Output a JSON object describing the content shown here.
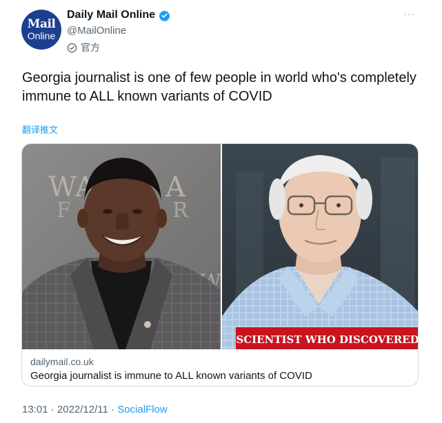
{
  "account": {
    "name": "Daily Mail Online",
    "handle": "@MailOnline",
    "official_label": "官方",
    "avatar_line1": "Mail",
    "avatar_line2": "Online",
    "verified_icon": "verified-badge-icon",
    "brand_color": "#1c3f8f"
  },
  "tweet": {
    "text": "Georgia journalist is one of few people in world who's completely immune to ALL known variants of COVID",
    "translate_label": "翻译推文",
    "more_label": "···"
  },
  "card": {
    "image_caption": "SCIENTIST WHO DISCOVERED",
    "backdrop_letters_1": "WA",
    "backdrop_letters_2": "A",
    "backdrop_letters_3": "F",
    "backdrop_letters_4": "R",
    "backdrop_letters_5": "W",
    "domain": "dailymail.co.uk",
    "title": "Georgia journalist is immune to ALL known variants of COVID",
    "caption_color": "#c8141e"
  },
  "footer": {
    "time": "13:01",
    "separator": " · ",
    "date": "2022/12/11",
    "source": "SocialFlow"
  }
}
